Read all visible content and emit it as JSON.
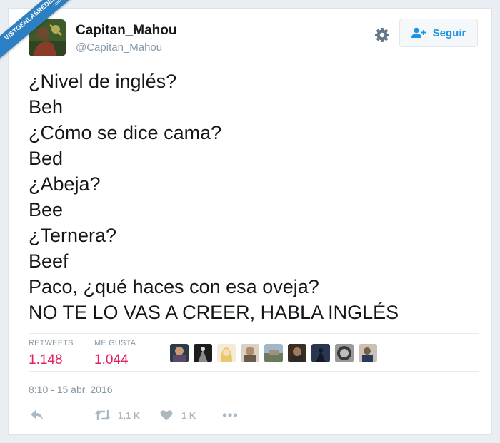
{
  "watermark": {
    "main": "VISTOENLASREDES",
    "sub": ".com"
  },
  "user": {
    "name": "Capitan_Mahou",
    "handle": "@Capitan_Mahou"
  },
  "follow": {
    "label": "Seguir"
  },
  "tweet": {
    "lines": [
      "¿Nivel de inglés?",
      "Beh",
      "¿Cómo se dice cama?",
      "Bed",
      "¿Abeja?",
      "Bee",
      "¿Ternera?",
      "Beef",
      "Paco, ¿qué haces con esa oveja?",
      "NO TE LO VAS A CREER, HABLA INGLÉS"
    ]
  },
  "stats": {
    "retweets": {
      "label": "RETWEETS",
      "value": "1.148"
    },
    "likes": {
      "label": "ME GUSTA",
      "value": "1.044"
    }
  },
  "timestamp": "8:10 - 15 abr. 2016",
  "actions": {
    "reply": {
      "icon": "reply-icon"
    },
    "retweet": {
      "icon": "retweet-icon",
      "count": "1,1 K"
    },
    "like": {
      "icon": "heart-icon",
      "count": "1 K"
    },
    "more": {
      "icon": "more-icon"
    }
  },
  "colors": {
    "accent": "#1c94e0",
    "like_count": "#e0245e",
    "muted": "#8899a6",
    "text": "#14171a",
    "ribbon": "#2b7fc2"
  }
}
